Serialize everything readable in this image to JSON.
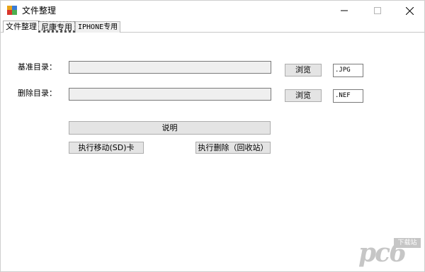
{
  "window": {
    "title": "文件整理",
    "controls": {
      "minimize": "—",
      "maximize": "☐",
      "close": "✕"
    }
  },
  "tabs": [
    {
      "label": "文件整理"
    },
    {
      "label": "尼康专用"
    },
    {
      "label": "IPHONE专用"
    }
  ],
  "form": {
    "base_dir_label": "基准目录：",
    "base_dir_value": "",
    "delete_dir_label": "删除目录：",
    "delete_dir_value": "",
    "browse_label": "浏览",
    "base_ext": ".JPG",
    "delete_ext": ".NEF",
    "help_button": "说明",
    "move_button": "执行移动(SD)卡",
    "delete_button": "执行删除（回收站）"
  },
  "watermark": {
    "logo_text": "pc6",
    "sub_text": "下载站"
  }
}
